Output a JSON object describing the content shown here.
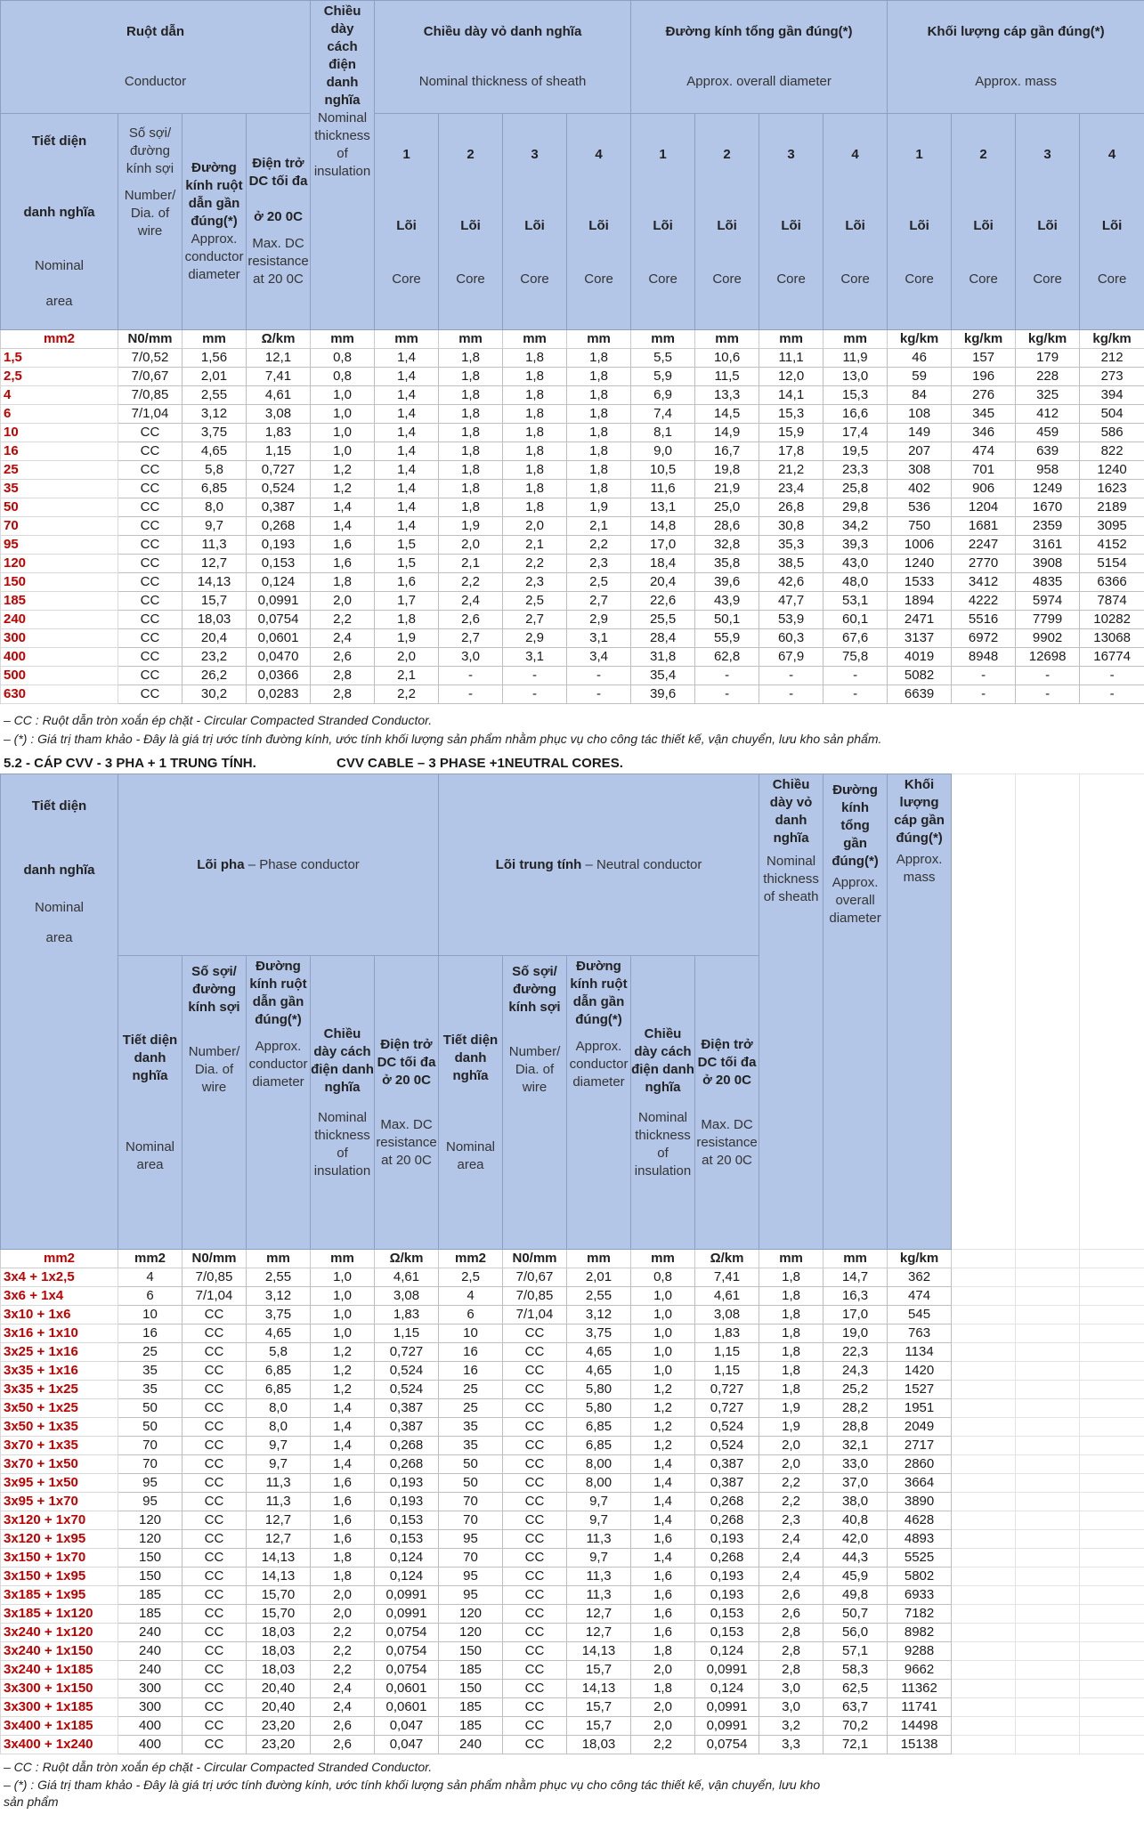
{
  "t1": {
    "h_conductor": "Ruột dẫn",
    "h_conductor_en": "Conductor",
    "h_ins": "Chiều dày cách điện danh nghĩa",
    "h_ins_en": "Nominal thickness of insulation",
    "h_sheath": "Chiều dày vỏ danh nghĩa",
    "h_sheath_en": "Nominal thickness of sheath",
    "h_dia": "Đường kính tổng gần đúng(*)",
    "h_dia_en": "Approx. overall diameter",
    "h_mass": "Khối lượng cáp gần đúng(*)",
    "h_mass_en": "Approx. mass",
    "h_area": "Tiết diện",
    "h_area2": "danh nghĩa",
    "h_area_en": "Nominal",
    "h_area_en2": "area",
    "h_wire": "Số sợi/đường kính sợi",
    "h_wire_en": "Number/ Dia. of wire",
    "h_cdia": "Đường kính ruột dẫn gần đúng(*)",
    "h_cdia_en": "Approx. conductor diameter",
    "h_res": "Điện trở DC tối đa",
    "h_res2": "ở 20 0C",
    "h_res_en": "Max. DC resistance at 20 0C",
    "core_vi": "Lõi",
    "core_en": "Core",
    "cores": [
      "1",
      "2",
      "3",
      "4"
    ],
    "units": [
      "mm2",
      "N0/mm",
      "mm",
      "Ω/km",
      "mm",
      "mm",
      "mm",
      "mm",
      "mm",
      "mm",
      "mm",
      "mm",
      "mm",
      "kg/km",
      "kg/km",
      "kg/km",
      "kg/km"
    ],
    "rows": [
      [
        "1,5",
        "7/0,52",
        "1,56",
        "12,1",
        "0,8",
        "1,4",
        "1,8",
        "1,8",
        "1,8",
        "5,5",
        "10,6",
        "11,1",
        "11,9",
        "46",
        "157",
        "179",
        "212"
      ],
      [
        "2,5",
        "7/0,67",
        "2,01",
        "7,41",
        "0,8",
        "1,4",
        "1,8",
        "1,8",
        "1,8",
        "5,9",
        "11,5",
        "12,0",
        "13,0",
        "59",
        "196",
        "228",
        "273"
      ],
      [
        "4",
        "7/0,85",
        "2,55",
        "4,61",
        "1,0",
        "1,4",
        "1,8",
        "1,8",
        "1,8",
        "6,9",
        "13,3",
        "14,1",
        "15,3",
        "84",
        "276",
        "325",
        "394"
      ],
      [
        "6",
        "7/1,04",
        "3,12",
        "3,08",
        "1,0",
        "1,4",
        "1,8",
        "1,8",
        "1,8",
        "7,4",
        "14,5",
        "15,3",
        "16,6",
        "108",
        "345",
        "412",
        "504"
      ],
      [
        "10",
        "CC",
        "3,75",
        "1,83",
        "1,0",
        "1,4",
        "1,8",
        "1,8",
        "1,8",
        "8,1",
        "14,9",
        "15,9",
        "17,4",
        "149",
        "346",
        "459",
        "586"
      ],
      [
        "16",
        "CC",
        "4,65",
        "1,15",
        "1,0",
        "1,4",
        "1,8",
        "1,8",
        "1,8",
        "9,0",
        "16,7",
        "17,8",
        "19,5",
        "207",
        "474",
        "639",
        "822"
      ],
      [
        "25",
        "CC",
        "5,8",
        "0,727",
        "1,2",
        "1,4",
        "1,8",
        "1,8",
        "1,8",
        "10,5",
        "19,8",
        "21,2",
        "23,3",
        "308",
        "701",
        "958",
        "1240"
      ],
      [
        "35",
        "CC",
        "6,85",
        "0,524",
        "1,2",
        "1,4",
        "1,8",
        "1,8",
        "1,8",
        "11,6",
        "21,9",
        "23,4",
        "25,8",
        "402",
        "906",
        "1249",
        "1623"
      ],
      [
        "50",
        "CC",
        "8,0",
        "0,387",
        "1,4",
        "1,4",
        "1,8",
        "1,8",
        "1,9",
        "13,1",
        "25,0",
        "26,8",
        "29,8",
        "536",
        "1204",
        "1670",
        "2189"
      ],
      [
        "70",
        "CC",
        "9,7",
        "0,268",
        "1,4",
        "1,4",
        "1,9",
        "2,0",
        "2,1",
        "14,8",
        "28,6",
        "30,8",
        "34,2",
        "750",
        "1681",
        "2359",
        "3095"
      ],
      [
        "95",
        "CC",
        "11,3",
        "0,193",
        "1,6",
        "1,5",
        "2,0",
        "2,1",
        "2,2",
        "17,0",
        "32,8",
        "35,3",
        "39,3",
        "1006",
        "2247",
        "3161",
        "4152"
      ],
      [
        "120",
        "CC",
        "12,7",
        "0,153",
        "1,6",
        "1,5",
        "2,1",
        "2,2",
        "2,3",
        "18,4",
        "35,8",
        "38,5",
        "43,0",
        "1240",
        "2770",
        "3908",
        "5154"
      ],
      [
        "150",
        "CC",
        "14,13",
        "0,124",
        "1,8",
        "1,6",
        "2,2",
        "2,3",
        "2,5",
        "20,4",
        "39,6",
        "42,6",
        "48,0",
        "1533",
        "3412",
        "4835",
        "6366"
      ],
      [
        "185",
        "CC",
        "15,7",
        "0,0991",
        "2,0",
        "1,7",
        "2,4",
        "2,5",
        "2,7",
        "22,6",
        "43,9",
        "47,7",
        "53,1",
        "1894",
        "4222",
        "5974",
        "7874"
      ],
      [
        "240",
        "CC",
        "18,03",
        "0,0754",
        "2,2",
        "1,8",
        "2,6",
        "2,7",
        "2,9",
        "25,5",
        "50,1",
        "53,9",
        "60,1",
        "2471",
        "5516",
        "7799",
        "10282"
      ],
      [
        "300",
        "CC",
        "20,4",
        "0,0601",
        "2,4",
        "1,9",
        "2,7",
        "2,9",
        "3,1",
        "28,4",
        "55,9",
        "60,3",
        "67,6",
        "3137",
        "6972",
        "9902",
        "13068"
      ],
      [
        "400",
        "CC",
        "23,2",
        "0,0470",
        "2,6",
        "2,0",
        "3,0",
        "3,1",
        "3,4",
        "31,8",
        "62,8",
        "67,9",
        "75,8",
        "4019",
        "8948",
        "12698",
        "16774"
      ],
      [
        "500",
        "CC",
        "26,2",
        "0,0366",
        "2,8",
        "2,1",
        "-",
        "-",
        "-",
        "35,4",
        "-",
        "-",
        "-",
        "5082",
        "-",
        "-",
        "-"
      ],
      [
        "630",
        "CC",
        "30,2",
        "0,0283",
        "2,8",
        "2,2",
        "-",
        "-",
        "-",
        "39,6",
        "-",
        "-",
        "-",
        "6639",
        "-",
        "-",
        "-"
      ]
    ]
  },
  "notes1": {
    "cc": "– CC   :  Ruột dẫn tròn xoắn ép chặt - Circular Compacted Stranded Conductor.",
    "ref": "   – (*)    : Giá trị tham khảo - Đây là giá trị ước tính đường kính, ước tính khối lượng sản phẩm nhằm phục vụ cho công tác thiết kế, vận chuyển, lưu kho sản phẩm."
  },
  "section52": {
    "title_vi": "5.2 - CÁP CVV - 3 PHA + 1 TRUNG TÍNH.",
    "title_en": "CVV CABLE – 3 PHASE +1NEUTRAL CORES."
  },
  "t2": {
    "h_area": "Tiết diện",
    "h_area2": "danh nghĩa",
    "h_area_en": "Nominal",
    "h_area_en2": "area",
    "h_phase_b": "Lõi pha",
    "h_phase_n": " – Phase conductor",
    "h_neutral_b": "Lõi trung tính",
    "h_neutral_n": " – Neutral conductor",
    "h_sheath": "Chiều dày vỏ danh nghĩa",
    "h_sheath_en": "Nominal thickness of sheath",
    "h_dia": "Đường kính tổng gần đúng(*)",
    "h_dia_en": "Approx. overall diameter",
    "h_mass": "Khối lượng cáp gần đúng(*)",
    "h_mass_en": "Approx. mass",
    "s_area": "Tiết diện danh nghĩa",
    "s_area_en": "Nominal area",
    "s_wire": "Số sợi/đường kính sợi",
    "s_wire_en": "Number/ Dia. of wire",
    "s_cdia": "Đường kính ruột dẫn gần đúng(*)",
    "s_cdia_en": "Approx. conductor diameter",
    "s_ins": "Chiều dày cách điện danh nghĩa",
    "s_ins_en": "Nominal thickness of insulation",
    "s_res": "Điện trở DC tối đa ở 20 0C",
    "s_res_en": "Max. DC resistance at 20 0C",
    "units": [
      "mm2",
      "mm2",
      "N0/mm",
      "mm",
      "mm",
      "Ω/km",
      "mm2",
      "N0/mm",
      "mm",
      "mm",
      "Ω/km",
      "mm",
      "mm",
      "kg/km"
    ],
    "rows": [
      [
        "3x4 + 1x2,5",
        "4",
        "7/0,85",
        "2,55",
        "1,0",
        "4,61",
        "2,5",
        "7/0,67",
        "2,01",
        "0,8",
        "7,41",
        "1,8",
        "14,7",
        "362"
      ],
      [
        "3x6 + 1x4",
        "6",
        "7/1,04",
        "3,12",
        "1,0",
        "3,08",
        "4",
        "7/0,85",
        "2,55",
        "1,0",
        "4,61",
        "1,8",
        "16,3",
        "474"
      ],
      [
        "3x10 + 1x6",
        "10",
        "CC",
        "3,75",
        "1,0",
        "1,83",
        "6",
        "7/1,04",
        "3,12",
        "1,0",
        "3,08",
        "1,8",
        "17,0",
        "545"
      ],
      [
        "3x16 + 1x10",
        "16",
        "CC",
        "4,65",
        "1,0",
        "1,15",
        "10",
        "CC",
        "3,75",
        "1,0",
        "1,83",
        "1,8",
        "19,0",
        "763"
      ],
      [
        "3x25 + 1x16",
        "25",
        "CC",
        "5,8",
        "1,2",
        "0,727",
        "16",
        "CC",
        "4,65",
        "1,0",
        "1,15",
        "1,8",
        "22,3",
        "1134"
      ],
      [
        "3x35 + 1x16",
        "35",
        "CC",
        "6,85",
        "1,2",
        "0,524",
        "16",
        "CC",
        "4,65",
        "1,0",
        "1,15",
        "1,8",
        "24,3",
        "1420"
      ],
      [
        "3x35 + 1x25",
        "35",
        "CC",
        "6,85",
        "1,2",
        "0,524",
        "25",
        "CC",
        "5,80",
        "1,2",
        "0,727",
        "1,8",
        "25,2",
        "1527"
      ],
      [
        "3x50 + 1x25",
        "50",
        "CC",
        "8,0",
        "1,4",
        "0,387",
        "25",
        "CC",
        "5,80",
        "1,2",
        "0,727",
        "1,9",
        "28,2",
        "1951"
      ],
      [
        "3x50 + 1x35",
        "50",
        "CC",
        "8,0",
        "1,4",
        "0,387",
        "35",
        "CC",
        "6,85",
        "1,2",
        "0,524",
        "1,9",
        "28,8",
        "2049"
      ],
      [
        "3x70 + 1x35",
        "70",
        "CC",
        "9,7",
        "1,4",
        "0,268",
        "35",
        "CC",
        "6,85",
        "1,2",
        "0,524",
        "2,0",
        "32,1",
        "2717"
      ],
      [
        "3x70 + 1x50",
        "70",
        "CC",
        "9,7",
        "1,4",
        "0,268",
        "50",
        "CC",
        "8,00",
        "1,4",
        "0,387",
        "2,0",
        "33,0",
        "2860"
      ],
      [
        "3x95 + 1x50",
        "95",
        "CC",
        "11,3",
        "1,6",
        "0,193",
        "50",
        "CC",
        "8,00",
        "1,4",
        "0,387",
        "2,2",
        "37,0",
        "3664"
      ],
      [
        "3x95 + 1x70",
        "95",
        "CC",
        "11,3",
        "1,6",
        "0,193",
        "70",
        "CC",
        "9,7",
        "1,4",
        "0,268",
        "2,2",
        "38,0",
        "3890"
      ],
      [
        "3x120 + 1x70",
        "120",
        "CC",
        "12,7",
        "1,6",
        "0,153",
        "70",
        "CC",
        "9,7",
        "1,4",
        "0,268",
        "2,3",
        "40,8",
        "4628"
      ],
      [
        "3x120 + 1x95",
        "120",
        "CC",
        "12,7",
        "1,6",
        "0,153",
        "95",
        "CC",
        "11,3",
        "1,6",
        "0,193",
        "2,4",
        "42,0",
        "4893"
      ],
      [
        "3x150 + 1x70",
        "150",
        "CC",
        "14,13",
        "1,8",
        "0,124",
        "70",
        "CC",
        "9,7",
        "1,4",
        "0,268",
        "2,4",
        "44,3",
        "5525"
      ],
      [
        "3x150 + 1x95",
        "150",
        "CC",
        "14,13",
        "1,8",
        "0,124",
        "95",
        "CC",
        "11,3",
        "1,6",
        "0,193",
        "2,4",
        "45,9",
        "5802"
      ],
      [
        "3x185 + 1x95",
        "185",
        "CC",
        "15,70",
        "2,0",
        "0,0991",
        "95",
        "CC",
        "11,3",
        "1,6",
        "0,193",
        "2,6",
        "49,8",
        "6933"
      ],
      [
        "3x185 + 1x120",
        "185",
        "CC",
        "15,70",
        "2,0",
        "0,0991",
        "120",
        "CC",
        "12,7",
        "1,6",
        "0,153",
        "2,6",
        "50,7",
        "7182"
      ],
      [
        "3x240 + 1x120",
        "240",
        "CC",
        "18,03",
        "2,2",
        "0,0754",
        "120",
        "CC",
        "12,7",
        "1,6",
        "0,153",
        "2,8",
        "56,0",
        "8982"
      ],
      [
        "3x240 + 1x150",
        "240",
        "CC",
        "18,03",
        "2,2",
        "0,0754",
        "150",
        "CC",
        "14,13",
        "1,8",
        "0,124",
        "2,8",
        "57,1",
        "9288"
      ],
      [
        "3x240 + 1x185",
        "240",
        "CC",
        "18,03",
        "2,2",
        "0,0754",
        "185",
        "CC",
        "15,7",
        "2,0",
        "0,0991",
        "2,8",
        "58,3",
        "9662"
      ],
      [
        "3x300 + 1x150",
        "300",
        "CC",
        "20,40",
        "2,4",
        "0,0601",
        "150",
        "CC",
        "14,13",
        "1,8",
        "0,124",
        "3,0",
        "62,5",
        "11362"
      ],
      [
        "3x300 + 1x185",
        "300",
        "CC",
        "20,40",
        "2,4",
        "0,0601",
        "185",
        "CC",
        "15,7",
        "2,0",
        "0,0991",
        "3,0",
        "63,7",
        "11741"
      ],
      [
        "3x400 + 1x185",
        "400",
        "CC",
        "23,20",
        "2,6",
        "0,047",
        "185",
        "CC",
        "15,7",
        "2,0",
        "0,0991",
        "3,2",
        "70,2",
        "14498"
      ],
      [
        "3x400 + 1x240",
        "400",
        "CC",
        "23,20",
        "2,6",
        "0,047",
        "240",
        "CC",
        "18,03",
        "2,2",
        "0,0754",
        "3,3",
        "72,1",
        "15138"
      ]
    ]
  },
  "notes2": {
    "cc": "– CC   :  Ruột dẫn tròn xoắn ép chặt - Circular Compacted Stranded Conductor.",
    "ref1": "– (*)    : Giá trị tham khảo - Đây là giá trị ước tính đường kính, ước tính khối lượng sản phẩm nhằm phục vụ cho công tác thiết kế, vận chuyển, lưu kho",
    "ref2": "sản phẩm"
  }
}
